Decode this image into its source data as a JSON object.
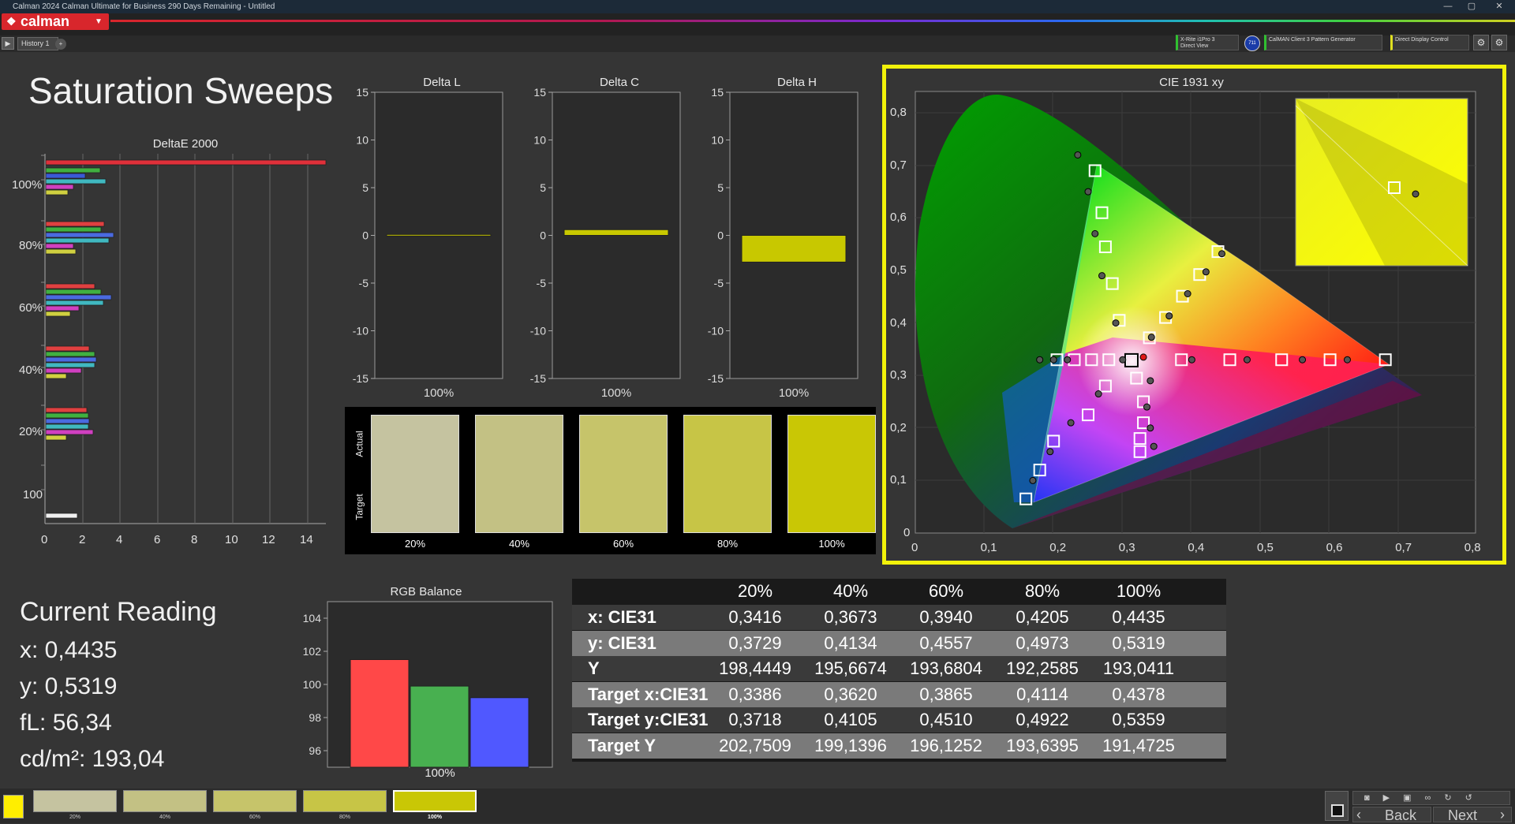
{
  "window": {
    "title": "Calman 2024 Calman Ultimate for Business 290 Days Remaining  - Untitled",
    "logo": "calman"
  },
  "tabs": {
    "history": "History 1"
  },
  "devices": {
    "meter_line1": "X-Rite i1Pro 3",
    "meter_line2": "Direct View",
    "meter_badge": "711",
    "generator": "CalMAN Client 3 Pattern Generator",
    "display": "Direct Display Control"
  },
  "page": {
    "title": "Saturation Sweeps"
  },
  "deltaE": {
    "title": "DeltaE 2000",
    "y_labels": [
      "100%",
      "80%",
      "60%",
      "40%",
      "20%",
      "100"
    ],
    "x_ticks": [
      "0",
      "2",
      "4",
      "6",
      "8",
      "10",
      "12",
      "14"
    ]
  },
  "delta_panels": [
    {
      "title": "Delta L",
      "label": "100%",
      "value": 0.1
    },
    {
      "title": "Delta C",
      "label": "100%",
      "value": 0.6
    },
    {
      "title": "Delta H",
      "label": "100%",
      "value": -2.8
    }
  ],
  "delta_ticks": [
    "15",
    "10",
    "5",
    "0",
    "-5",
    "-10",
    "-15"
  ],
  "swatches": {
    "actual_label": "Actual",
    "target_label": "Target",
    "items": [
      {
        "label": "20%",
        "color": "#c5c3a0"
      },
      {
        "label": "40%",
        "color": "#c3c184"
      },
      {
        "label": "60%",
        "color": "#c6c46a"
      },
      {
        "label": "80%",
        "color": "#c7c546"
      },
      {
        "label": "100%",
        "color": "#c9c705"
      }
    ]
  },
  "cie": {
    "title": "CIE 1931 xy",
    "x_ticks": [
      "0",
      "0,1",
      "0,2",
      "0,3",
      "0,4",
      "0,5",
      "0,6",
      "0,7",
      "0,8"
    ],
    "y_ticks": [
      "0",
      "0,1",
      "0,2",
      "0,3",
      "0,4",
      "0,5",
      "0,6",
      "0,7",
      "0,8"
    ]
  },
  "current_reading": {
    "title": "Current Reading",
    "x": "x: 0,4435",
    "y": "y: 0,5319",
    "fl": "fL: 56,34",
    "cdm2": "cd/m²: 193,04"
  },
  "rgb_balance": {
    "title": "RGB Balance",
    "label": "100%",
    "y_ticks": [
      "104",
      "102",
      "100",
      "98",
      "96"
    ],
    "values": {
      "r": 101.5,
      "g": 99.9,
      "b": 99.2
    }
  },
  "table": {
    "headers": [
      "20%",
      "40%",
      "60%",
      "80%",
      "100%"
    ],
    "rows": [
      {
        "label": "x: CIE31",
        "values": [
          "0,3416",
          "0,3673",
          "0,3940",
          "0,4205",
          "0,4435"
        ]
      },
      {
        "label": "y: CIE31",
        "values": [
          "0,3729",
          "0,4134",
          "0,4557",
          "0,4973",
          "0,5319"
        ]
      },
      {
        "label": "Y",
        "values": [
          "198,4449",
          "195,6674",
          "193,6804",
          "192,2585",
          "193,0411"
        ]
      },
      {
        "label": "Target x:CIE31",
        "values": [
          "0,3386",
          "0,3620",
          "0,3865",
          "0,4114",
          "0,4378"
        ]
      },
      {
        "label": "Target y:CIE31",
        "values": [
          "0,3718",
          "0,4105",
          "0,4510",
          "0,4922",
          "0,5359"
        ]
      },
      {
        "label": "Target Y",
        "values": [
          "202,7509",
          "199,1396",
          "196,1252",
          "193,6395",
          "191,4725"
        ]
      }
    ]
  },
  "bottom": {
    "swatches": [
      "20%",
      "40%",
      "60%",
      "80%",
      "100%"
    ],
    "back": "Back",
    "next": "Next"
  }
}
